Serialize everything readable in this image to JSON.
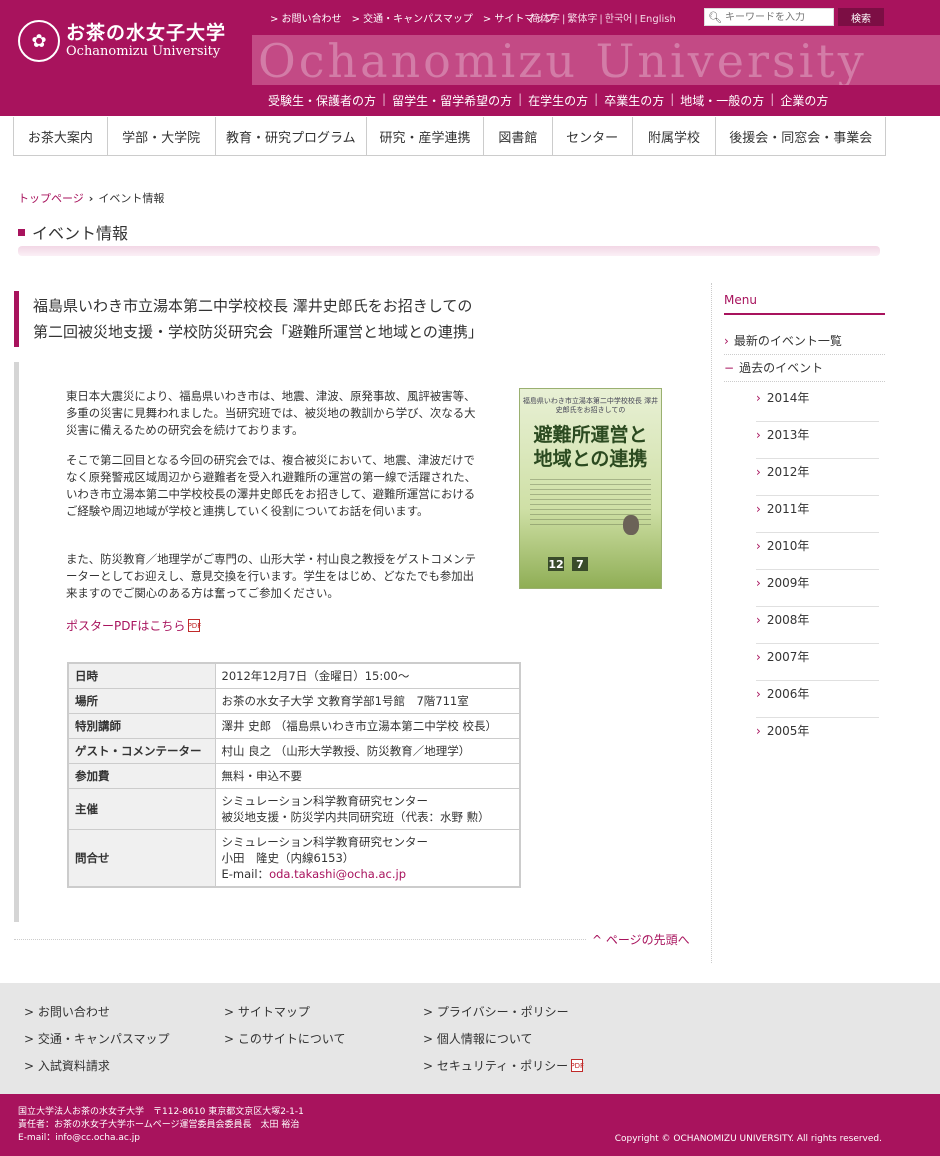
{
  "header": {
    "logo_jp": "お茶の水女子大学",
    "logo_en": "Ochanomizu University",
    "watermark": "Ochanomizu University",
    "top_links": [
      "> お問い合わせ",
      "> 交通・キャンパスマップ",
      "> サイトマップ"
    ],
    "languages": [
      "简体字",
      "繁体字",
      "한국어",
      "English"
    ],
    "search_placeholder": "キーワードを入力",
    "search_button": "検索"
  },
  "audience_nav": [
    "受験生・保護者の方",
    "留学生・留学希望の方",
    "在学生の方",
    "卒業生の方",
    "地域・一般の方",
    "企業の方"
  ],
  "global_nav": [
    "お茶大案内",
    "学部・大学院",
    "教育・研究プログラム",
    "研究・産学連携",
    "図書館",
    "センター",
    "附属学校",
    "後援会・同窓会・事業会"
  ],
  "breadcrumb": {
    "home": "トップページ",
    "current": "イベント情報"
  },
  "page_title": "イベント情報",
  "article": {
    "title_line1": "福島県いわき市立湯本第二中学校校長 澤井史郎氏をお招きしての",
    "title_line2": "第二回被災地支援・学校防災研究会「避難所運営と地域との連携」",
    "para1": "東日本大震災により、福島県いわき市は、地震、津波、原発事故、風評被害等、多重の災害に見舞われました。当研究班では、被災地の教訓から学び、次なる大災害に備えるための研究会を続けております。",
    "para2": "そこで第二回目となる今回の研究会では、複合被災において、地震、津波だけでなく原発警戒区域周辺から避難者を受入れ避難所の運営の第一線で活躍された、いわき市立湯本第二中学校校長の澤井史郎氏をお招きして、避難所運営におけるご経験や周辺地域が学校と連携していく役割についてお話を伺います。",
    "para3": "また、防災教育／地理学がご専門の、山形大学・村山良之教授をゲストコメンテーターとしてお迎えし、意見交換を行います。学生をはじめ、どなたでも参加出来ますのでご関心のある方は奮ってご参加ください。",
    "pdf_link": "ポスターPDFはこちら",
    "poster_top": "福島県いわき市立湯本第二中学校校長 澤井史郎氏をお招きしての",
    "poster_main_1": "避難所運営と",
    "poster_main_2": "地域との連携",
    "poster_date": [
      "12",
      "7"
    ]
  },
  "info_table": [
    {
      "label": "日時",
      "value": [
        "2012年12月7日（金曜日）15:00〜"
      ]
    },
    {
      "label": "場所",
      "value": [
        "お茶の水女子大学 文教育学部1号館　7階711室"
      ]
    },
    {
      "label": "特別講師",
      "value": [
        "澤井 史郎 （福島県いわき市立湯本第二中学校 校長）"
      ]
    },
    {
      "label": "ゲスト・コメンテーター",
      "value": [
        "村山 良之 （山形大学教授、防災教育／地理学）"
      ]
    },
    {
      "label": "参加費",
      "value": [
        "無料・申込不要"
      ]
    },
    {
      "label": "主催",
      "value": [
        "シミュレーション科学教育研究センター",
        "被災地支援・防災学内共同研究班（代表：水野 勲）"
      ]
    },
    {
      "label": "問合せ",
      "value": [
        "シミュレーション科学教育研究センター",
        "小田　隆史（内線6153）"
      ],
      "email_label": "E-mail：",
      "email": "oda.takashi@ocha.ac.jp"
    }
  ],
  "page_top": "ページの先頭へ",
  "sidebar": {
    "heading": "Menu",
    "latest": "最新のイベント一覧",
    "past": "過去のイベント",
    "years": [
      "2014年",
      "2013年",
      "2012年",
      "2011年",
      "2010年",
      "2009年",
      "2008年",
      "2007年",
      "2006年",
      "2005年"
    ]
  },
  "footer": {
    "col1": [
      "> お問い合わせ",
      "> 交通・キャンパスマップ",
      "> 入試資料請求"
    ],
    "col2": [
      "> サイトマップ",
      "> このサイトについて"
    ],
    "col3": [
      "> プライバシー・ポリシー",
      "> 個人情報について",
      "> セキュリティ・ポリシー"
    ],
    "address_1": "国立大学法人お茶の水女子大学　〒112-8610 東京都文京区大塚2-1-1",
    "address_2": "責任者：お茶の水女子大学ホームページ運営委員会委員長　太田 裕治",
    "address_3": "E-mail：info@cc.ocha.ac.jp",
    "copyright": "Copyright © OCHANOMIZU UNIVERSITY. All rights reserved."
  },
  "colors": {
    "brand": "#a8135d",
    "band": "#c34a85"
  }
}
